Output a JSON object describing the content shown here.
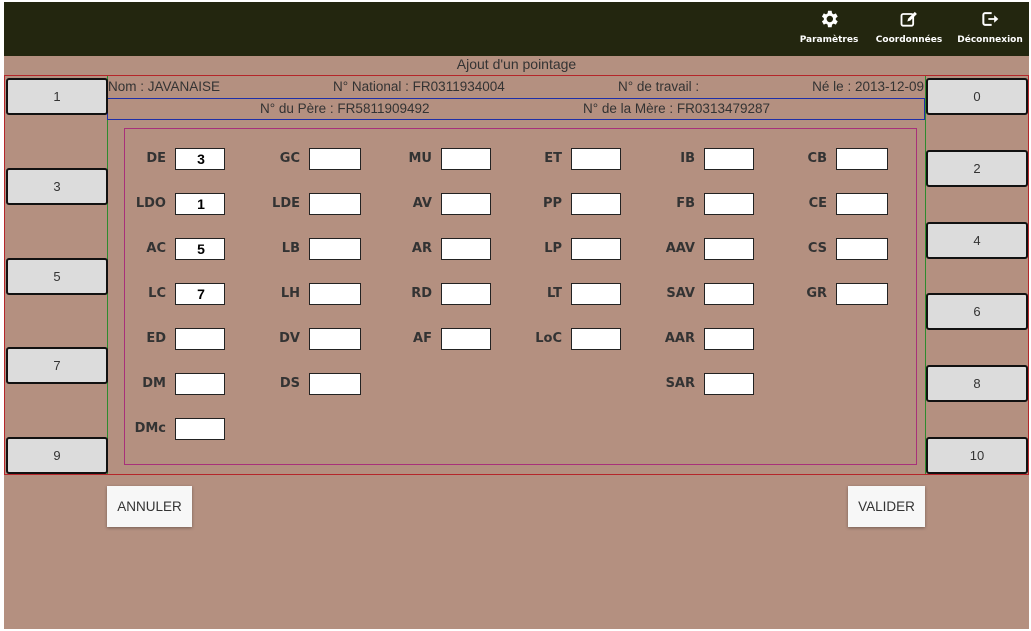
{
  "nav": {
    "settings_label": "Paramètres",
    "contact_label": "Coordonnées",
    "logout_label": "Déconnexion"
  },
  "page_title": "Ajout d'un pointage",
  "animal": {
    "name": "Nom : JAVANAISE",
    "national": "N° National : FR0311934004",
    "work": "N° de travail :",
    "birth": "Né le : 2013-12-09",
    "father": "N° du Père : FR5811909492",
    "mother": "N° de la Mère : FR0313479287"
  },
  "left_buttons": [
    "1",
    "3",
    "5",
    "7",
    "9"
  ],
  "right_buttons": [
    "0",
    "2",
    "4",
    "6",
    "8",
    "10"
  ],
  "fields": {
    "col1": [
      {
        "label": "DE",
        "value": "3"
      },
      {
        "label": "LDO",
        "value": "1"
      },
      {
        "label": "AC",
        "value": "5"
      },
      {
        "label": "LC",
        "value": "7"
      },
      {
        "label": "ED",
        "value": ""
      },
      {
        "label": "DM",
        "value": ""
      },
      {
        "label": "DMc",
        "value": ""
      }
    ],
    "col2": [
      {
        "label": "GC",
        "value": ""
      },
      {
        "label": "LDE",
        "value": ""
      },
      {
        "label": "LB",
        "value": ""
      },
      {
        "label": "LH",
        "value": ""
      },
      {
        "label": "DV",
        "value": ""
      },
      {
        "label": "DS",
        "value": ""
      }
    ],
    "col3": [
      {
        "label": "MU",
        "value": ""
      },
      {
        "label": "AV",
        "value": ""
      },
      {
        "label": "AR",
        "value": ""
      },
      {
        "label": "RD",
        "value": ""
      },
      {
        "label": "AF",
        "value": ""
      }
    ],
    "col4": [
      {
        "label": "ET",
        "value": ""
      },
      {
        "label": "PP",
        "value": ""
      },
      {
        "label": "LP",
        "value": ""
      },
      {
        "label": "LT",
        "value": ""
      },
      {
        "label": "LoC",
        "value": ""
      }
    ],
    "col5": [
      {
        "label": "IB",
        "value": ""
      },
      {
        "label": "FB",
        "value": ""
      },
      {
        "label": "AAV",
        "value": ""
      },
      {
        "label": "SAV",
        "value": ""
      },
      {
        "label": "AAR",
        "value": ""
      },
      {
        "label": "SAR",
        "value": ""
      }
    ],
    "col6": [
      {
        "label": "CB",
        "value": ""
      },
      {
        "label": "CE",
        "value": ""
      },
      {
        "label": "CS",
        "value": ""
      },
      {
        "label": "GR",
        "value": ""
      }
    ]
  },
  "actions": {
    "cancel_label": "ANNULER",
    "submit_label": "VALIDER"
  }
}
